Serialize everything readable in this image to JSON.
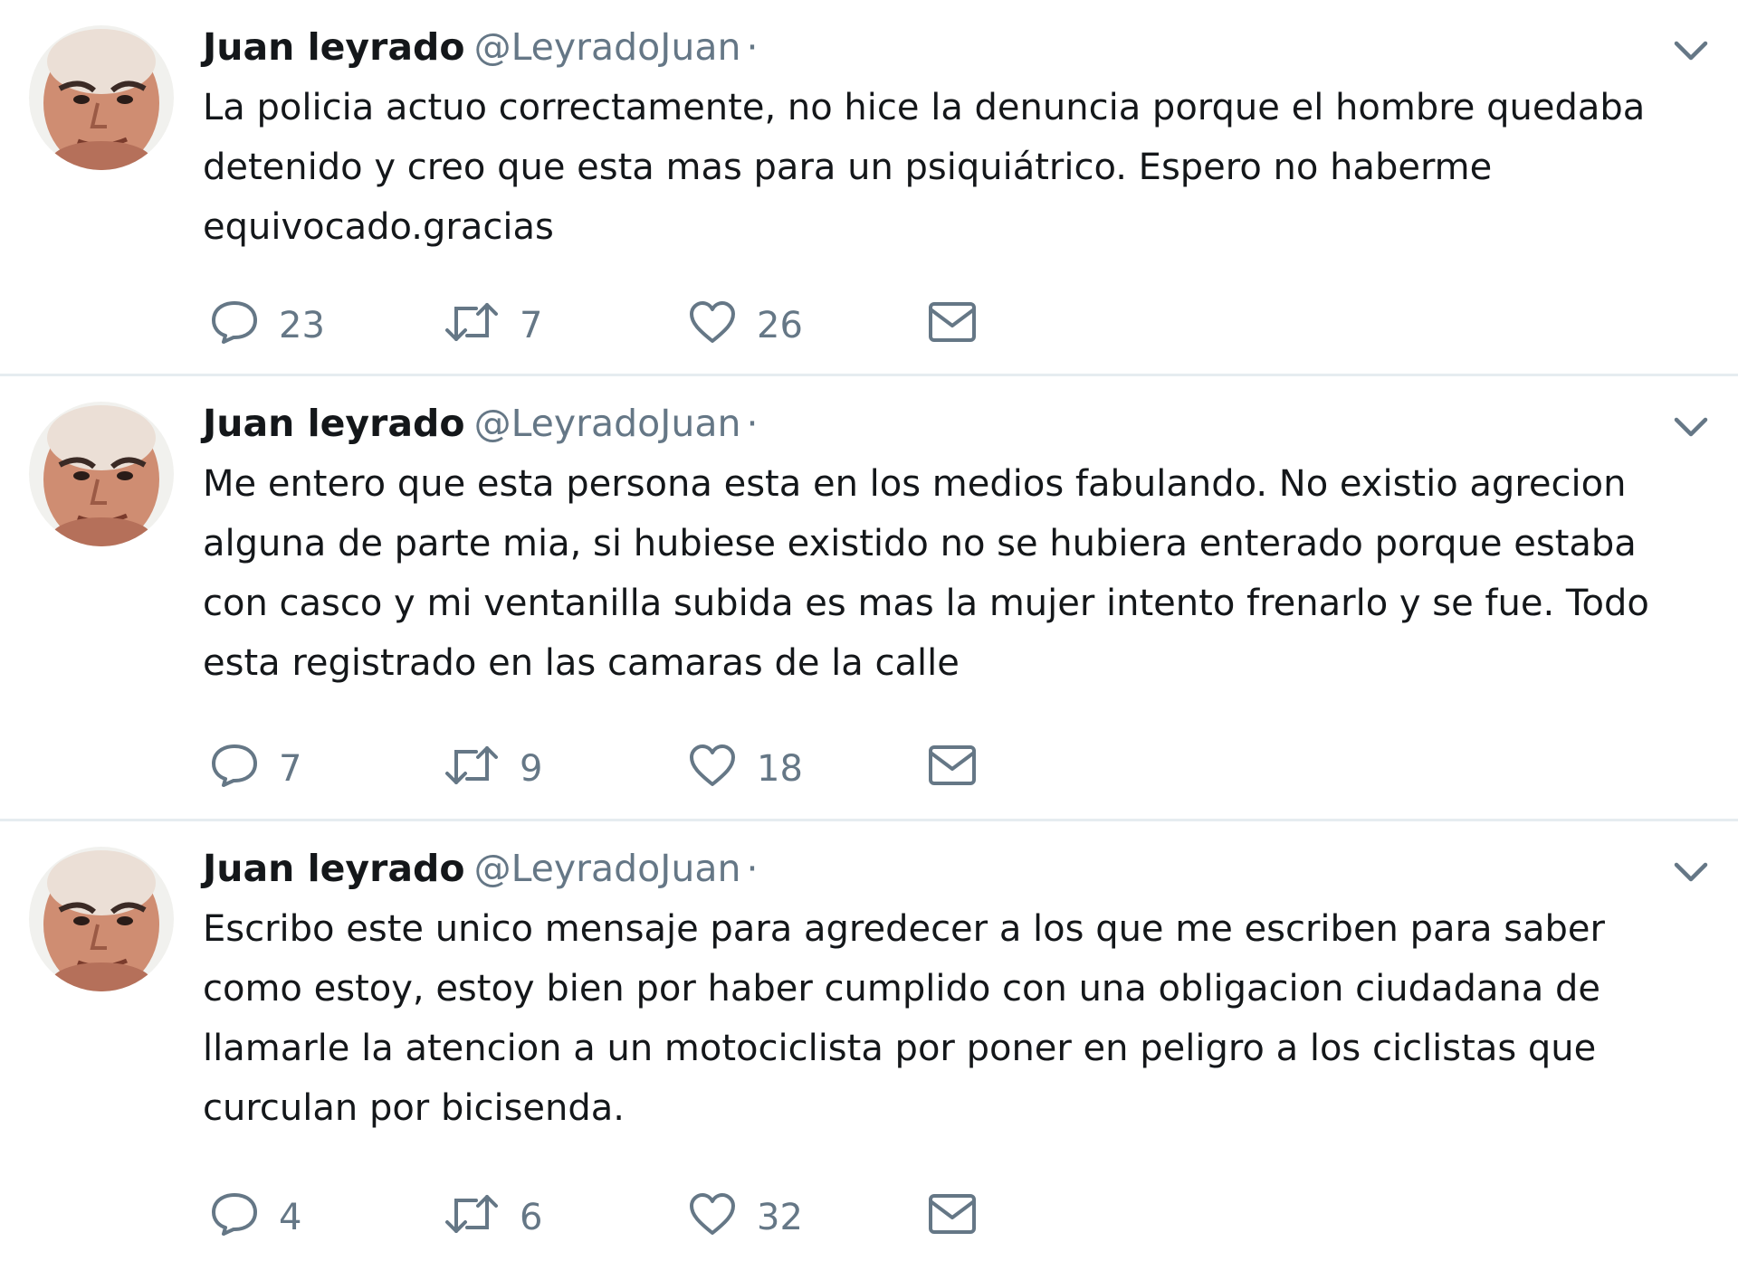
{
  "tweets": [
    {
      "display_name": "Juan leyrado",
      "handle": "@LeyradoJuan",
      "separator": "·",
      "text": "La policia actuo correctamente, no hice la denuncia porque el hombre quedaba detenido y creo que esta mas para un psiquiátrico. Espero no haberme equivocado.gracias",
      "replies": "23",
      "retweets": "7",
      "likes": "26"
    },
    {
      "display_name": "Juan leyrado",
      "handle": "@LeyradoJuan",
      "separator": "·",
      "text": "Me entero que esta persona esta en los medios fabulando. No existio agrecion alguna de parte mia, si hubiese existido no se hubiera enterado porque estaba con casco y mi ventanilla subida es mas la mujer intento frenarlo y se fue. Todo esta registrado en las camaras de la calle",
      "replies": "7",
      "retweets": "9",
      "likes": "18"
    },
    {
      "display_name": "Juan leyrado",
      "handle": "@LeyradoJuan",
      "separator": "·",
      "text": "Escribo este unico mensaje para agredecer a los que me escriben para saber como estoy, estoy bien por haber cumplido con una obligacion ciudadana de llamarle la atencion a un motociclista por poner en peligro a los ciclistas que curculan por bicisenda.",
      "replies": "4",
      "retweets": "6",
      "likes": "32"
    }
  ],
  "icons": {
    "reply": "reply-icon",
    "retweet": "retweet-icon",
    "like": "heart-icon",
    "dm": "envelope-icon",
    "caret": "chevron-down-icon"
  },
  "colors": {
    "text": "#14171a",
    "secondary": "#657786",
    "divider": "#e6ecf0"
  }
}
